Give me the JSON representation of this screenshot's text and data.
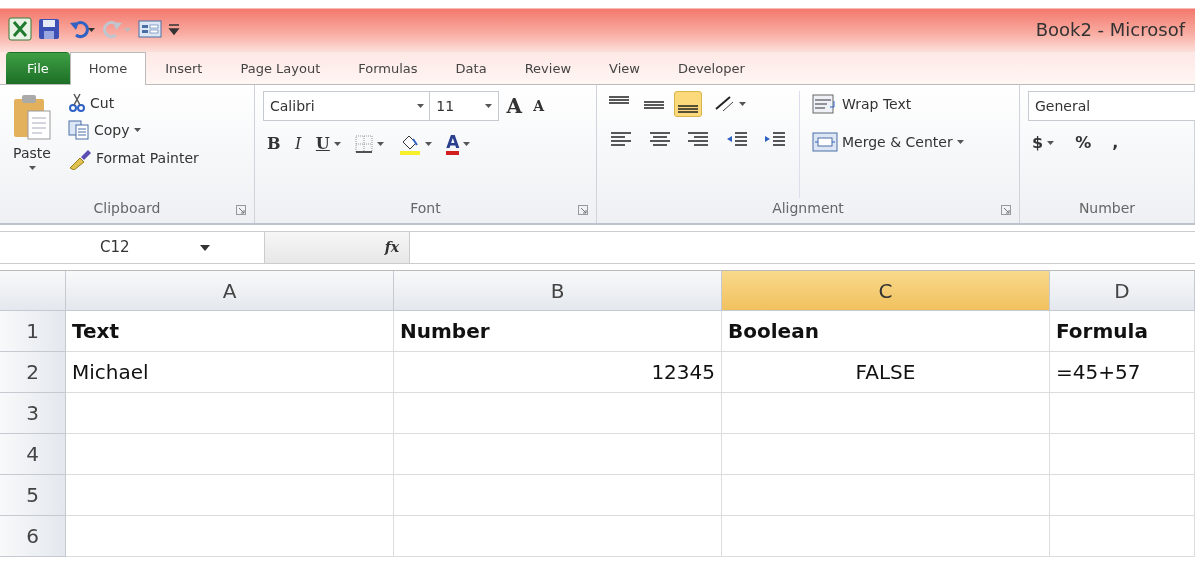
{
  "window": {
    "title": "Book2 - Microsof"
  },
  "tabs": [
    {
      "label": "File",
      "kind": "file",
      "selected": false
    },
    {
      "label": "Home",
      "kind": "tab",
      "selected": true
    },
    {
      "label": "Insert",
      "kind": "tab",
      "selected": false
    },
    {
      "label": "Page Layout",
      "kind": "tab",
      "selected": false
    },
    {
      "label": "Formulas",
      "kind": "tab",
      "selected": false
    },
    {
      "label": "Data",
      "kind": "tab",
      "selected": false
    },
    {
      "label": "Review",
      "kind": "tab",
      "selected": false
    },
    {
      "label": "View",
      "kind": "tab",
      "selected": false
    },
    {
      "label": "Developer",
      "kind": "tab",
      "selected": false
    }
  ],
  "ribbon": {
    "clipboard": {
      "label": "Clipboard",
      "paste": "Paste",
      "cut": "Cut",
      "copy": "Copy",
      "format_painter": "Format Painter"
    },
    "font": {
      "label": "Font",
      "family": "Calibri",
      "size": "11",
      "grow": "A",
      "shrink": "A",
      "bold": "B",
      "italic": "I",
      "underline": "U",
      "font_color": "A"
    },
    "alignment": {
      "label": "Alignment",
      "vertical": [
        {
          "selected": false
        },
        {
          "selected": false
        },
        {
          "selected": true
        }
      ],
      "wrap_text": "Wrap Text",
      "merge": "Merge & Center"
    },
    "number": {
      "label": "Number",
      "format": "General",
      "currency": "$",
      "percent": "%",
      "comma": ","
    }
  },
  "formula_bar": {
    "name_box": "C12",
    "fx": "fx"
  },
  "grid": {
    "columns": [
      {
        "label": "A",
        "selected": false
      },
      {
        "label": "B",
        "selected": false
      },
      {
        "label": "C",
        "selected": true
      },
      {
        "label": "D",
        "selected": false
      }
    ],
    "rows": [
      {
        "label": "1",
        "cells": [
          {
            "text": "Text",
            "kind": "header"
          },
          {
            "text": "Number",
            "kind": "header"
          },
          {
            "text": "Boolean",
            "kind": "header"
          },
          {
            "text": "Formula",
            "kind": "header"
          }
        ]
      },
      {
        "label": "2",
        "cells": [
          {
            "text": "Michael",
            "kind": "text"
          },
          {
            "text": "12345",
            "kind": "number"
          },
          {
            "text": "FALSE",
            "kind": "boolean"
          },
          {
            "text": "=45+57",
            "kind": "text"
          }
        ]
      },
      {
        "label": "3",
        "cells": []
      },
      {
        "label": "4",
        "cells": []
      },
      {
        "label": "5",
        "cells": []
      },
      {
        "label": "6",
        "cells": []
      }
    ]
  }
}
